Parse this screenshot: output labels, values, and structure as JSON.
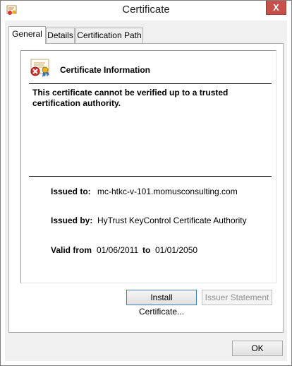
{
  "window": {
    "title": "Certificate",
    "close_glyph": "X"
  },
  "tabs": [
    {
      "label": "General",
      "active": true
    },
    {
      "label": "Details",
      "active": false
    },
    {
      "label": "Certification Path",
      "active": false
    }
  ],
  "info": {
    "heading": "Certificate Information",
    "icon": "certificate-error-icon",
    "warning_line1": "This certificate cannot be verified up to a trusted",
    "warning_line2": "certification authority."
  },
  "fields": {
    "issued_to_label": "Issued to:",
    "issued_to_value": "mc-htkc-v-101.momusconsulting.com",
    "issued_by_label": "Issued by:",
    "issued_by_value": "HyTrust KeyControl Certificate Authority",
    "valid_from_label": "Valid from",
    "valid_from_value": "01/06/2011",
    "valid_to_label": "to",
    "valid_to_value": "01/01/2050"
  },
  "buttons": {
    "install": "Install Certificate...",
    "issuer_statement": "Issuer Statement",
    "ok": "OK"
  },
  "colors": {
    "close_button": "#c7504a",
    "dialog_background": "#f0f0f0",
    "focus_border": "#3c7fb1"
  }
}
